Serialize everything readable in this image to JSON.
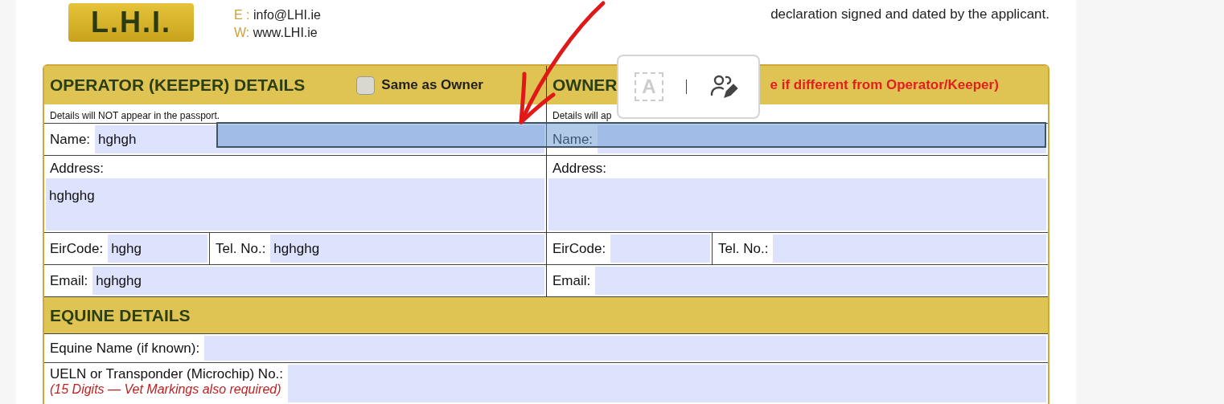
{
  "header": {
    "logo": "L.H.I.",
    "contact": [
      {
        "label": "E :",
        "value": "info@LHI.ie"
      },
      {
        "label": "W:",
        "value": "www.LHI.ie"
      }
    ],
    "note": "declaration signed and dated by the applicant."
  },
  "operator": {
    "title": "OPERATOR (KEEPER) DETAILS",
    "same_as_owner": {
      "label": "Same as Owner",
      "checked": false
    },
    "subtitle": "Details will NOT appear in the passport.",
    "name": {
      "label": "Name:",
      "value": "hghgh"
    },
    "address": {
      "label": "Address:",
      "value": "hghghg"
    },
    "eircode": {
      "label": "EirCode:",
      "value": "hghg"
    },
    "tel": {
      "label": "Tel. No.:",
      "value": "hghghg"
    },
    "email": {
      "label": "Email:",
      "value": "hghghg"
    }
  },
  "owner": {
    "title": "OWNER",
    "note": "e if different from Operator/Keeper)",
    "subtitle": "Details will ap",
    "name": {
      "label": "Name:"
    },
    "address": {
      "label": "Address:"
    },
    "eircode": {
      "label": "EirCode:"
    },
    "tel": {
      "label": "Tel. No.:"
    },
    "email": {
      "label": "Email:"
    }
  },
  "equine": {
    "title": "EQUINE DETAILS",
    "fields": [
      {
        "label": "Equine Name (if known):"
      },
      {
        "label": "UELN or Transponder (Microchip) No.:",
        "hint": "(15 Digits — Vet Markings also required)"
      }
    ]
  },
  "popup": {
    "glyph": "A"
  }
}
